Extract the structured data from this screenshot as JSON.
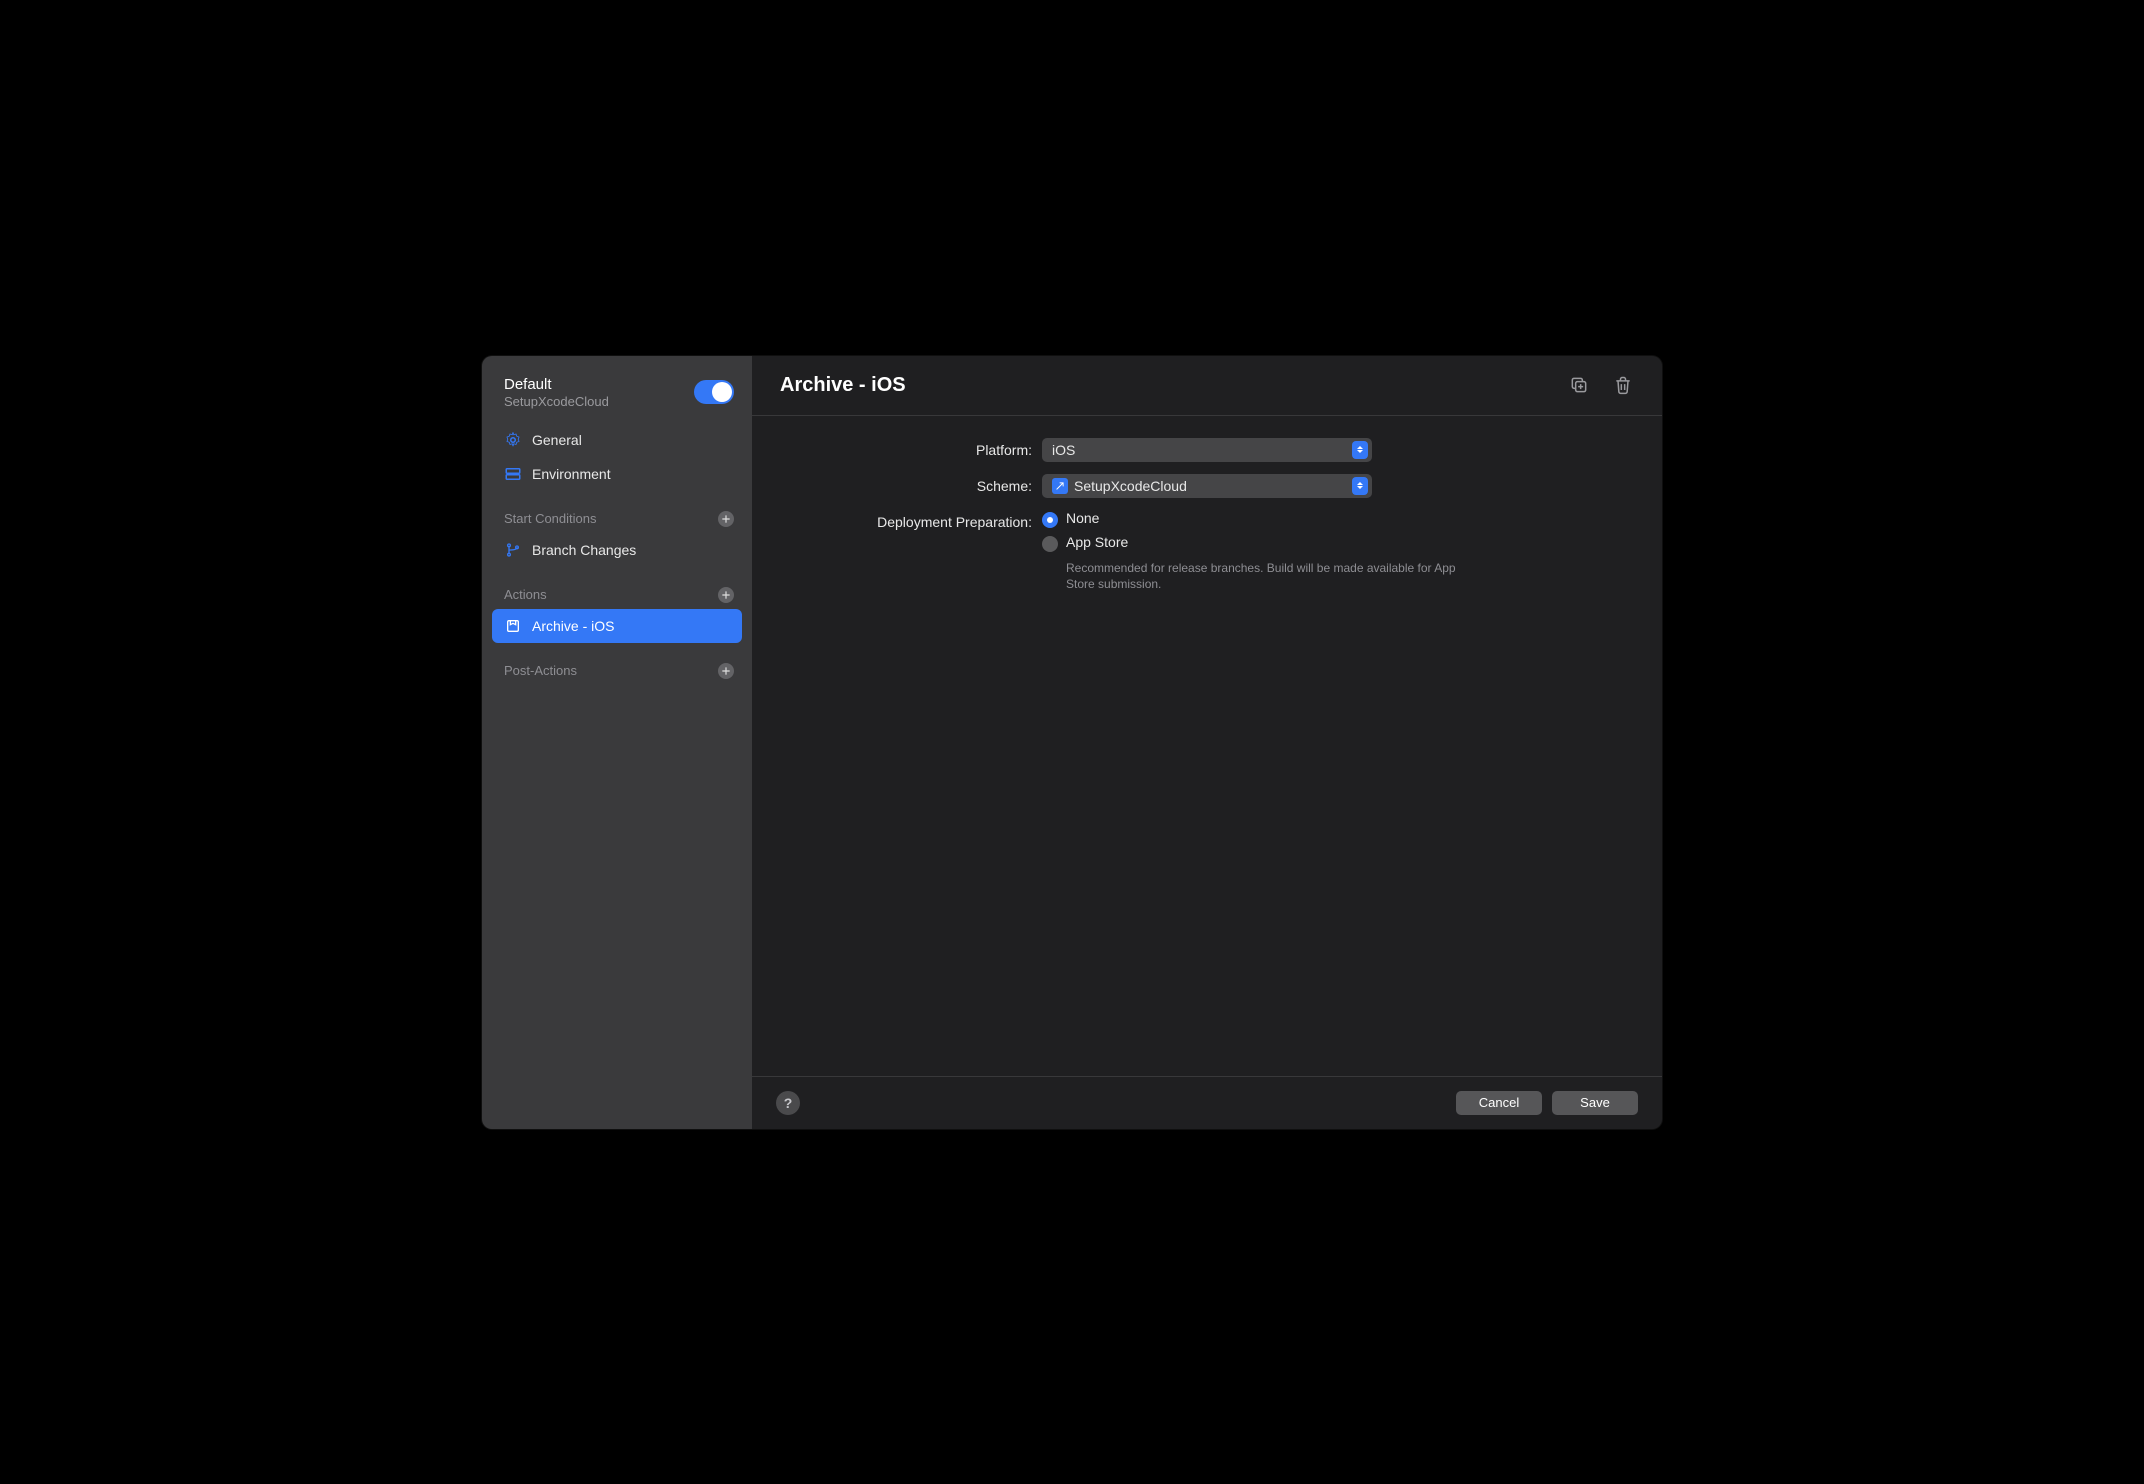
{
  "sidebar": {
    "title": "Default",
    "subtitle": "SetupXcodeCloud",
    "nav": {
      "general": "General",
      "environment": "Environment"
    },
    "sections": {
      "start_conditions": {
        "label": "Start Conditions",
        "items": [
          "Branch Changes"
        ]
      },
      "actions": {
        "label": "Actions",
        "items": [
          "Archive - iOS"
        ]
      },
      "post_actions": {
        "label": "Post-Actions"
      }
    }
  },
  "main": {
    "title": "Archive - iOS",
    "form": {
      "platform_label": "Platform:",
      "platform_value": "iOS",
      "scheme_label": "Scheme:",
      "scheme_value": "SetupXcodeCloud",
      "deployment_label": "Deployment Preparation:",
      "deployment_options": {
        "none": "None",
        "app_store": "App Store",
        "app_store_desc": "Recommended for release branches. Build will be made available for App Store submission."
      }
    }
  },
  "footer": {
    "cancel": "Cancel",
    "save": "Save"
  }
}
